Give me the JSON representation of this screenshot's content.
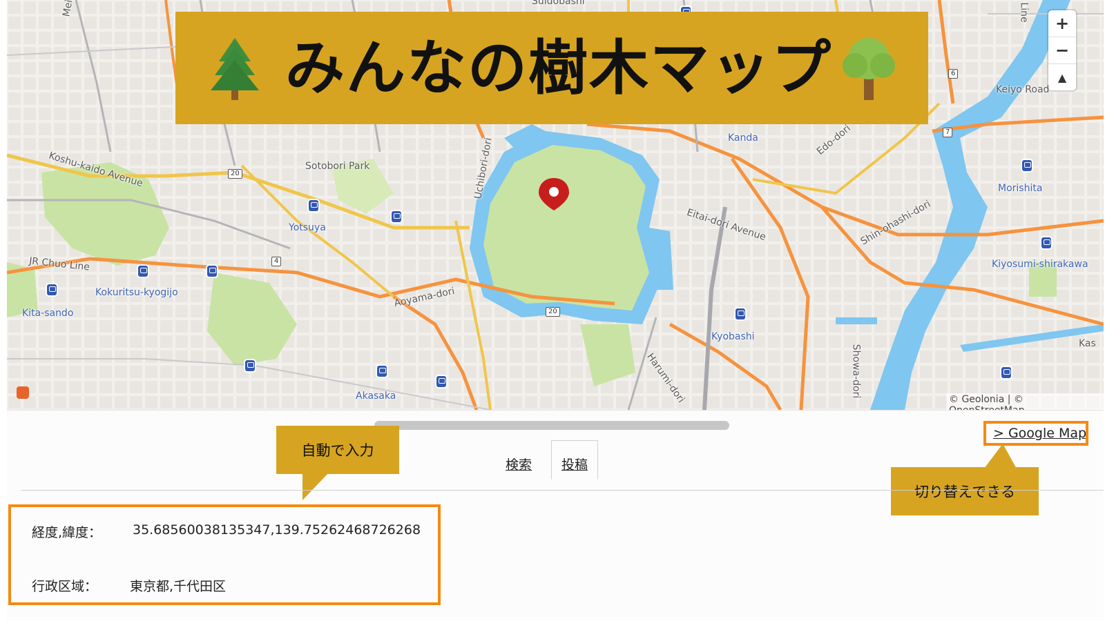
{
  "header": {
    "title": "みんなの樹木マップ",
    "left_icon": "evergreen-tree-icon",
    "right_icon": "deciduous-tree-icon"
  },
  "map": {
    "labels": {
      "koshu": "Koshu-kaido Avenue",
      "sotobori": "Sotobori Park",
      "uchibori": "Uchibori-dori",
      "yotsuya": "Yotsuya",
      "jrchuo": "JR Chuo Line",
      "kokuritsu": "Kokuritsu-kyogijo",
      "kitasando": "Kita-sando",
      "aoyama": "Aoyama-dori",
      "akasaka": "Akasaka",
      "kanda": "Kanda",
      "edo": "Edo-dori",
      "eitai": "Eitai-dori Avenue",
      "kyobashi": "Kyobashi",
      "harumi": "Harumi-dori",
      "shinohashi": "Shin-ohashi-dori",
      "morishita": "Morishita",
      "kiyosumi": "Kiyosumi-shirakawa",
      "keiyo": "Keiyo Road",
      "kas": "Kas",
      "sotobori_top": "Suidobashi",
      "mei": "Mei",
      "line": "Line",
      "showa": "Showa-dori"
    },
    "shields": {
      "r20a": "20",
      "r20b": "20",
      "r4": "4",
      "r6": "6",
      "r7": "7"
    },
    "zoom": {
      "in": "+",
      "out": "−",
      "compass": "▲"
    },
    "attribution": "© Geolonia | © OpenStreetMap"
  },
  "panel": {
    "google_map_link": "> Google Map",
    "tabs": [
      {
        "label": "検索",
        "active": false
      },
      {
        "label": "投稿",
        "active": true
      }
    ],
    "callout_auto": "自動で入力",
    "callout_switch": "切り替えできる",
    "coords_label": "経度,緯度：",
    "coords_value": "35.68560038135347,139.75262468726268",
    "region_label": "行政区域：",
    "region_value": "東京都,千代田区"
  },
  "colors": {
    "banner": "#d7a422",
    "highlight": "#f58a12",
    "water": "#7fc6f0",
    "park": "#c9e3a4",
    "road_major": "#f6933e",
    "road_yellow": "#f0c64a"
  }
}
